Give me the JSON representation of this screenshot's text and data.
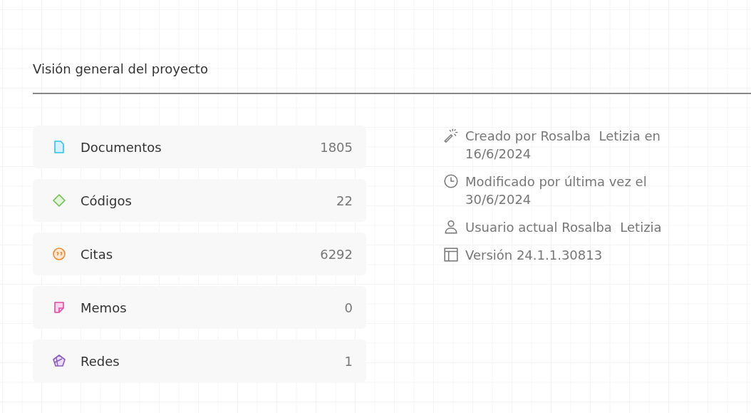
{
  "title": "Visión general del proyecto",
  "stats": [
    {
      "kind": "document",
      "label": "Documentos",
      "count": "1805"
    },
    {
      "kind": "code",
      "label": "Códigos",
      "count": "22"
    },
    {
      "kind": "quote",
      "label": "Citas",
      "count": "6292"
    },
    {
      "kind": "memo",
      "label": "Memos",
      "count": "0"
    },
    {
      "kind": "network",
      "label": "Redes",
      "count": "1"
    }
  ],
  "info": [
    {
      "kind": "created",
      "text": "Creado por Rosalba  Letizia en 16/6/2024"
    },
    {
      "kind": "modified",
      "text": "Modificado por última vez el 30/6/2024"
    },
    {
      "kind": "user",
      "text": "Usuario actual Rosalba  Letizia"
    },
    {
      "kind": "version",
      "text": "Versión 24.1.1.30813"
    }
  ]
}
